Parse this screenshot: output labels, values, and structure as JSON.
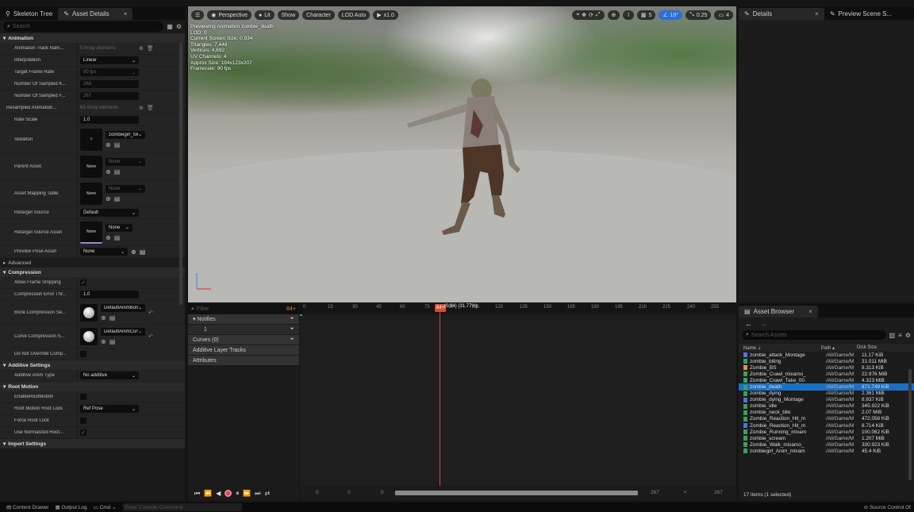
{
  "left_tabs": [
    {
      "label": "Skeleton Tree"
    },
    {
      "label": "Asset Details",
      "close": "×"
    }
  ],
  "search_placeholder": "Search",
  "animation_section": "Animation",
  "rows": {
    "track_names": {
      "label": "Animation Track Nam...",
      "value": "0 Array elements"
    },
    "interpolation": {
      "label": "Interpolation",
      "value": "Linear"
    },
    "target_frame_rate": {
      "label": "Target Frame Rate",
      "value": "90 fps"
    },
    "sampled_keys": {
      "label": "Number Of Sampled K...",
      "value": "268"
    },
    "sampled_frames": {
      "label": "Number Of Sampled F...",
      "value": "267"
    },
    "resampled": {
      "label": "Resampled Animation...",
      "value": "63 Array elements"
    },
    "rate_scale": {
      "label": "Rate Scale",
      "value": "1.0"
    },
    "skeleton": {
      "label": "Skeleton",
      "value": "zombiegirl_Skele"
    },
    "parent_asset": {
      "label": "Parent Asset",
      "thumb": "None",
      "value": "None"
    },
    "mapping_table": {
      "label": "Asset Mapping Table",
      "thumb": "None",
      "value": "None"
    },
    "retarget_source": {
      "label": "Retarget Source",
      "value": "Default"
    },
    "retarget_source_asset": {
      "label": "Retarget Source Asset",
      "thumb": "None",
      "value": "None"
    },
    "preview_pose": {
      "label": "Preview Pose Asset",
      "value": "None"
    }
  },
  "advanced_label": "Advanced",
  "compression_section": "Compression",
  "compression_rows": {
    "allow_stripping": {
      "label": "Allow Frame Stripping"
    },
    "error_threshold": {
      "label": "Compression Error Thr...",
      "value": "1.0"
    },
    "bone_compression": {
      "label": "Bone Compression Se...",
      "value": "DefaultAnimBone"
    },
    "curve_compression": {
      "label": "Curve Compression S...",
      "value": "DefaultAnimCurv"
    },
    "do_not_override": {
      "label": "Do Not Override Comp..."
    }
  },
  "additive_section": "Additive Settings",
  "additive_type": {
    "label": "Additive Anim Type",
    "value": "No additive"
  },
  "root_motion_section": "Root Motion",
  "root_rows": {
    "enable": {
      "label": "EnableRootMotion"
    },
    "lock": {
      "label": "Root Motion Root Lock",
      "value": "Ref Pose"
    },
    "force": {
      "label": "Force Root Lock"
    },
    "normalized": {
      "label": "Use Normalized Root..."
    }
  },
  "import_section": "Import Settings",
  "viewport": {
    "toolbar": {
      "perspective": "Perspective",
      "lit": "Lit",
      "show": "Show",
      "character": "Character",
      "lod": "LOD Auto",
      "play": "x1.0",
      "grid_num": "5",
      "angle": "10°",
      "scale": "0.25",
      "cam": "4"
    },
    "info": [
      "Previewing Animation zombie_death",
      "LOD: 0",
      "Current Screen Size: 0.934",
      "Triangles: 7,448",
      "Vertices: 4,692",
      "UV Channels: 4",
      "Approx Size: 194x123x207",
      "Framerate: 90 fps"
    ]
  },
  "timeline": {
    "filter_placeholder": "Filter",
    "count": "84+",
    "notifies": "Notifies",
    "notify_track": "1",
    "curves": "Curves (0)",
    "additive_tracks": "Additive Layer Tracks",
    "attributes": "Attributes",
    "ruler": [
      "0",
      "15",
      "30",
      "45",
      "60",
      "75",
      "90",
      "105",
      "120",
      "135",
      "150",
      "165",
      "180",
      "195",
      "210",
      "225",
      "240",
      "255"
    ],
    "playhead_frame": "84+",
    "playhead_text": "(0.94) (31.77%)",
    "bottom": {
      "start": "0",
      "a": "0",
      "b": "0",
      "end1": "267",
      "end2": "267"
    }
  },
  "right_tabs": [
    {
      "label": "Details",
      "close": "×"
    },
    {
      "label": "Preview Scene S..."
    }
  ],
  "asset_browser": {
    "tab": "Asset Browser",
    "close": "×",
    "search_placeholder": "Search Assets",
    "columns": {
      "name": "Name",
      "path": "Path",
      "size": "Disk Size"
    },
    "items": [
      {
        "name": "zombie_attack_Montage",
        "path": "/All/Game/M",
        "size": "11.17 KiB",
        "color": "#5570e0"
      },
      {
        "name": "zombie_biting",
        "path": "/All/Game/M",
        "size": "31.011 MiB",
        "color": "#3aa05a"
      },
      {
        "name": "Zombie_BS",
        "path": "/All/Game/M",
        "size": "8.313 KiB",
        "color": "#e0905a"
      },
      {
        "name": "Zombie_Crawl_mixamo_",
        "path": "/All/Game/M",
        "size": "22.976 MiB",
        "color": "#3aa05a"
      },
      {
        "name": "Zombie_Crawl_Take_00",
        "path": "/All/Game/M",
        "size": "4.323 MiB",
        "color": "#3aa05a"
      },
      {
        "name": "zombie_death",
        "path": "/All/Game/M",
        "size": "671.749 KiB",
        "color": "#3aa05a",
        "selected": true
      },
      {
        "name": "zombie_dying",
        "path": "/All/Game/M",
        "size": "2.361 MiB",
        "color": "#3aa05a"
      },
      {
        "name": "zombie_dying_Montage",
        "path": "/All/Game/M",
        "size": "8.937 KiB",
        "color": "#5570e0"
      },
      {
        "name": "zombie_idle",
        "path": "/All/Game/M",
        "size": "345.922 KiB",
        "color": "#3aa05a"
      },
      {
        "name": "zombie_neck_bite",
        "path": "/All/Game/M",
        "size": "2.07 MiB",
        "color": "#3aa05a"
      },
      {
        "name": "Zombie_Reaction_Hit_m",
        "path": "/All/Game/M",
        "size": "472.058 KiB",
        "color": "#3aa05a"
      },
      {
        "name": "Zombie_Reaction_Hit_m",
        "path": "/All/Game/M",
        "size": "8.714 KiB",
        "color": "#5570e0"
      },
      {
        "name": "Zombie_Running_mixam",
        "path": "/All/Game/M",
        "size": "100.062 KiB",
        "color": "#3aa05a"
      },
      {
        "name": "zombie_scream",
        "path": "/All/Game/M",
        "size": "1.207 MiB",
        "color": "#3aa05a"
      },
      {
        "name": "Zombie_Walk_mixamo_",
        "path": "/All/Game/M",
        "size": "330.923 KiB",
        "color": "#3aa05a"
      },
      {
        "name": "zombiegirl_Anim_mixam",
        "path": "/All/Game/M",
        "size": "45.4 KiB",
        "color": "#3aa05a"
      }
    ],
    "footer": "17 items (1 selected)"
  },
  "statusbar": {
    "content_drawer": "Content Drawer",
    "output_log": "Output Log",
    "cmd": "Cmd",
    "console_placeholder": "Enter Console Command",
    "source_control": "Source Control Of"
  },
  "colors": {
    "accent": "#1b6fc2",
    "playhead": "#d24e36",
    "record": "#d2446a"
  }
}
